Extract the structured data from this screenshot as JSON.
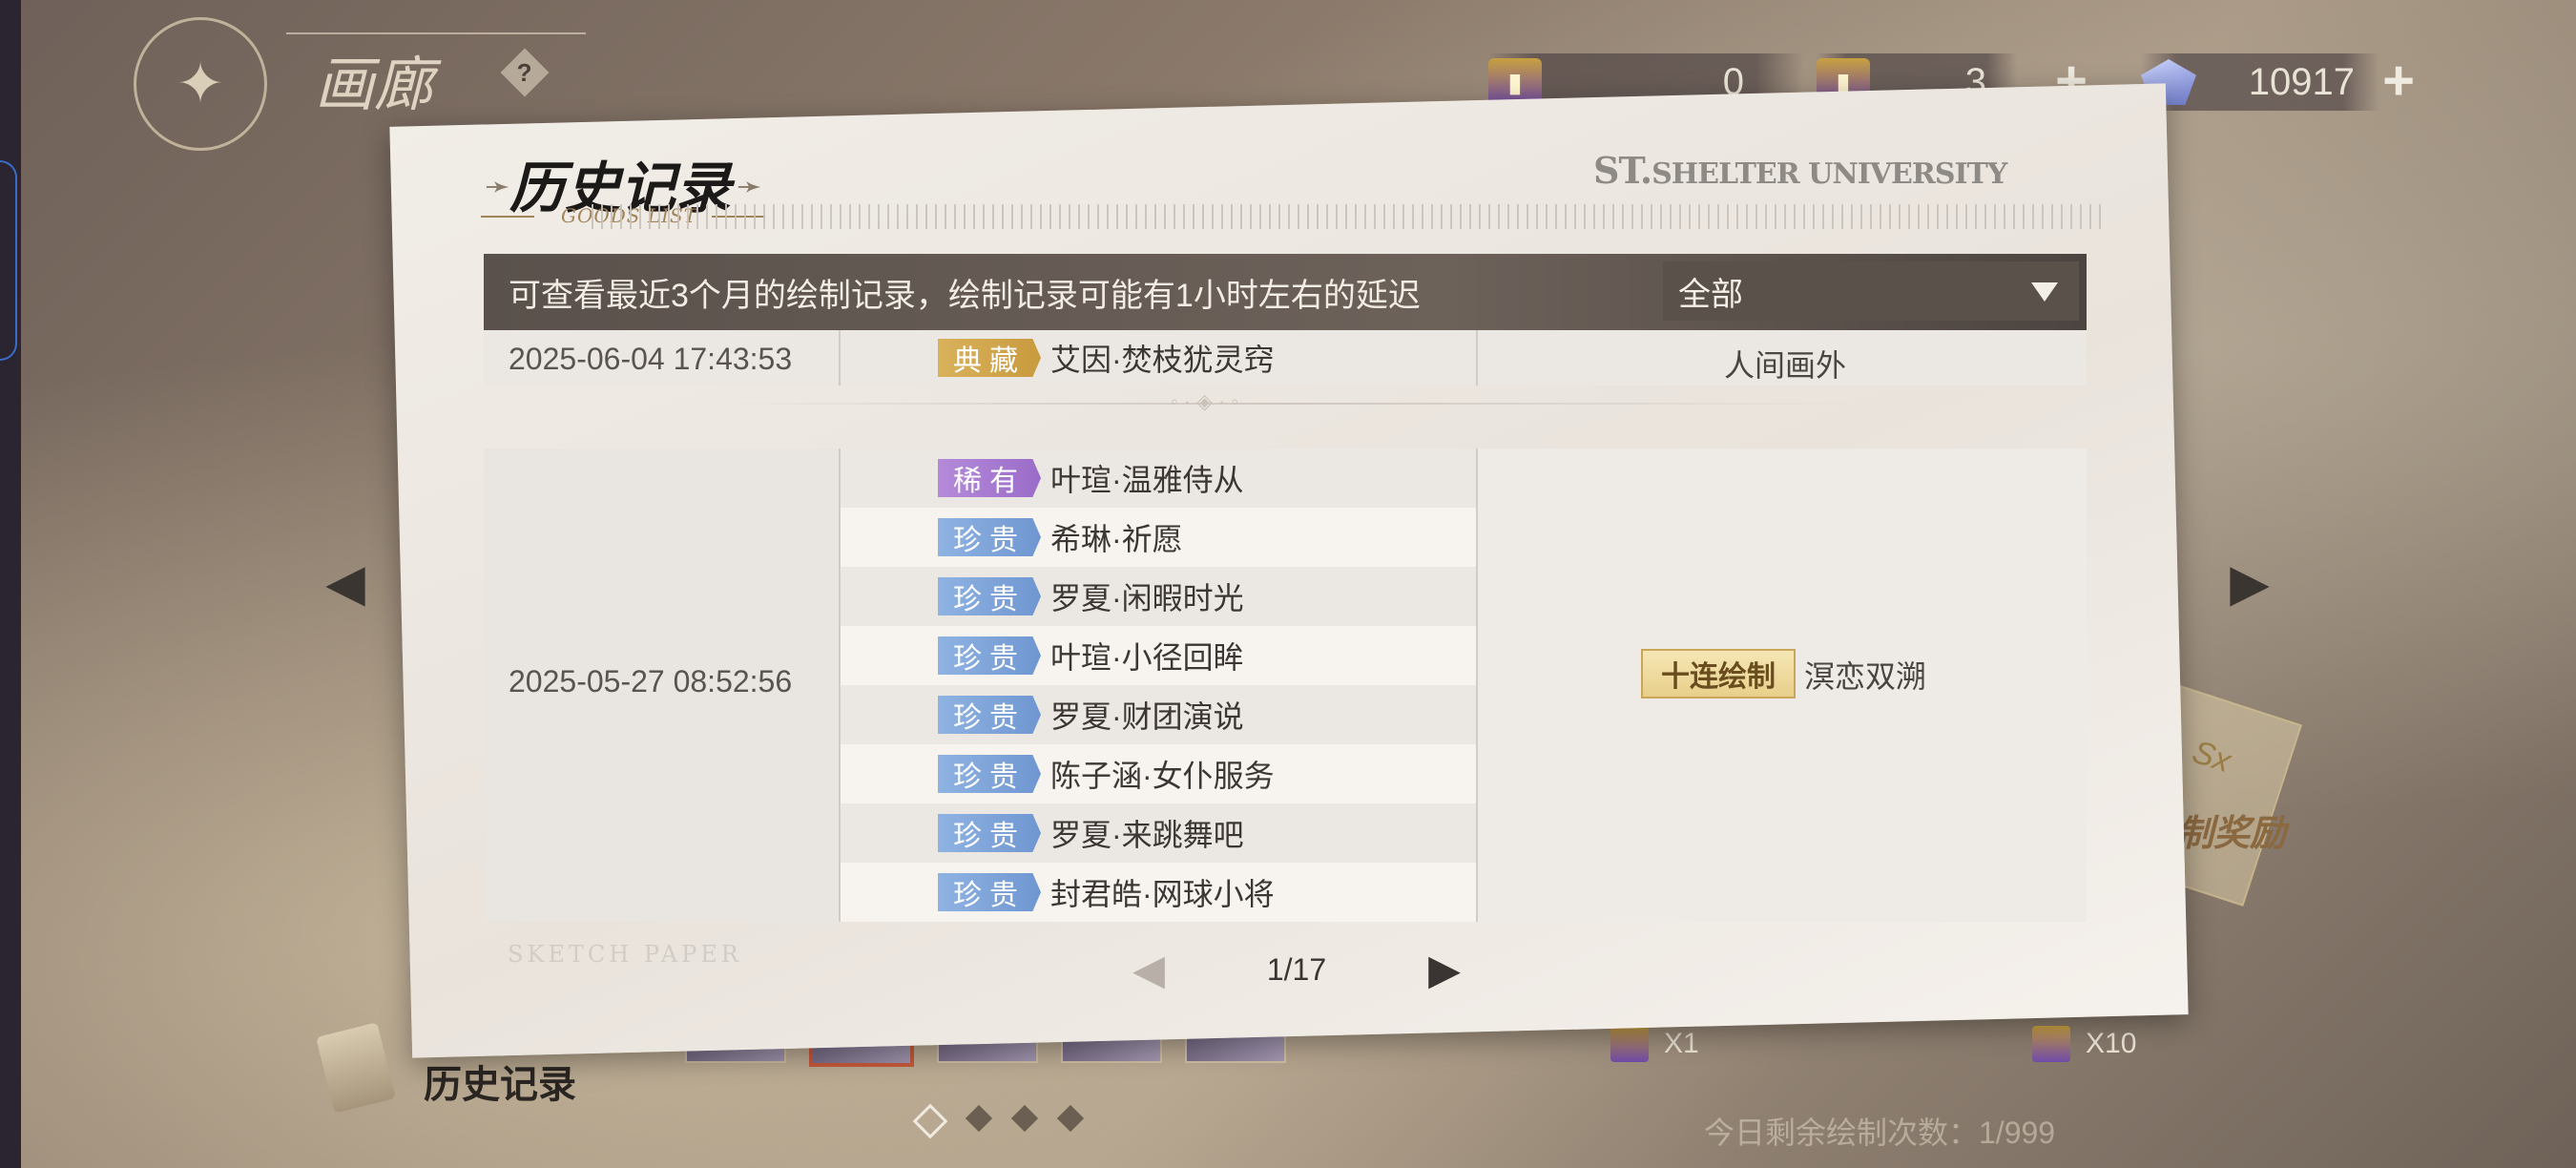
{
  "top_bar": {
    "gallery_title": "画廊",
    "help_icon": "?",
    "currencies": [
      {
        "name": "ticket-single",
        "value": "0"
      },
      {
        "name": "ticket-ten",
        "value": "3"
      },
      {
        "name": "gem",
        "value": "10917"
      }
    ],
    "plus_label": "+"
  },
  "modal": {
    "title": "历史记录",
    "subtitle": "GOODS LIST",
    "brand_prefix": "ST.",
    "brand_main": "SHELTER UNIVERSITY",
    "info_text": "可查看最近3个月的绘制记录，绘制记录可能有1小时左右的延迟",
    "filter_value": "全部",
    "records": [
      {
        "time": "2025-06-04  17:43:53",
        "items": [
          {
            "rarity": "典藏",
            "name": "艾因·焚枝犹灵窍"
          }
        ],
        "pool": "人间画外"
      },
      {
        "time": "2025-05-27  08:52:56",
        "badge": "十连绘制",
        "pool": "溟恋双溯",
        "items": [
          {
            "rarity": "稀有",
            "name": "叶瑄·温雅侍从"
          },
          {
            "rarity": "珍贵",
            "name": "希琳·祈愿"
          },
          {
            "rarity": "珍贵",
            "name": "罗夏·闲暇时光"
          },
          {
            "rarity": "珍贵",
            "name": "叶瑄·小径回眸"
          },
          {
            "rarity": "珍贵",
            "name": "罗夏·财团演说"
          },
          {
            "rarity": "珍贵",
            "name": "陈子涵·女仆服务"
          },
          {
            "rarity": "珍贵",
            "name": "罗夏·来跳舞吧"
          },
          {
            "rarity": "珍贵",
            "name": "封君皓·网球小将"
          }
        ]
      }
    ],
    "sketch_label": "SKETCH PAPER",
    "pager_text": "1/17"
  },
  "bottom": {
    "history_label": "历史记录",
    "draw_x1": "X1",
    "draw_x10": "X10",
    "remaining": "今日剩余绘制次数：1/999",
    "reward_text": "制奖励",
    "sx_label": "Sx"
  },
  "colors": {
    "legend": "#d4a94e",
    "rare": "#a97bd2",
    "precious": "#7fa3da",
    "header_bar": "#5f5650"
  }
}
